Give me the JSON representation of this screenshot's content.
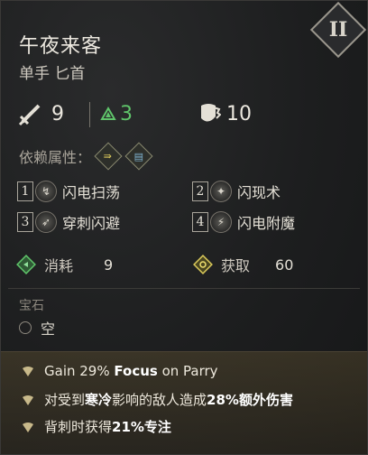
{
  "item": {
    "name": "午夜来客",
    "type": "单手 匕首",
    "tier": "II"
  },
  "stats": {
    "damage": "9",
    "upgrade": "3",
    "block": "10"
  },
  "dependency": {
    "label": "依赖属性："
  },
  "skills": [
    {
      "num": "1",
      "label": "闪电扫荡"
    },
    {
      "num": "2",
      "label": "闪现术"
    },
    {
      "num": "3",
      "label": "穿刺闪避"
    },
    {
      "num": "4",
      "label": "闪电附魔"
    }
  ],
  "cost": {
    "consume_label": "消耗",
    "consume_value": "9",
    "gain_label": "获取",
    "gain_value": "60"
  },
  "gem": {
    "title": "宝石",
    "slot_label": "空"
  },
  "effects": {
    "e1": {
      "a": "Gain 29% ",
      "b": "Focus",
      "c": " on Parry"
    },
    "e2": {
      "a": "对受到",
      "b": "寒冷",
      "c": "影响的敌人造成",
      "d": "28%额外伤害"
    },
    "e3": {
      "a": "背刺时获得",
      "b": "21%专注"
    }
  },
  "colors": {
    "upgrade_green": "#5fc46a",
    "effects_band": "#5a4a2a"
  }
}
